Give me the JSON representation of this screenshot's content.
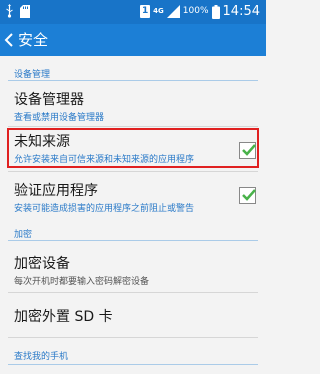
{
  "status_bar": {
    "sim_slot": "1",
    "network": "4G",
    "battery": "100%",
    "time": "14:54",
    "icons": [
      "usb-icon",
      "sd-card-icon",
      "sim-badge",
      "signal-icon",
      "battery-icon"
    ]
  },
  "header": {
    "title": "安全",
    "back_icon": "chevron-left-icon"
  },
  "sections": {
    "device_management": "设备管理",
    "encryption": "加密",
    "find_my_phone": "查找我的手机"
  },
  "items": {
    "device_admin": {
      "title": "设备管理器",
      "subtitle": "查看或禁用设备管理器"
    },
    "unknown_sources": {
      "title": "未知来源",
      "subtitle": "允许安装来自可信来源和未知来源的应用程序",
      "checked": true
    },
    "verify_apps": {
      "title": "验证应用程序",
      "subtitle": "安装可能造成损害的应用程序之前阻止或警告",
      "checked": true
    },
    "encrypt_device": {
      "title": "加密设备",
      "subtitle": "每次开机时都要输入密码解密设备"
    },
    "encrypt_sd": {
      "title": "加密外置 SD 卡"
    }
  },
  "colors": {
    "header": "#1c7fd6",
    "status_bar": "#1874c8",
    "accent": "#2a7ac8",
    "check": "#49b24a",
    "highlight": "#e02020"
  }
}
